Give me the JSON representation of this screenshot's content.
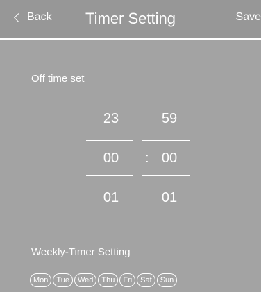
{
  "header": {
    "back_label": "Back",
    "title": "Timer Setting",
    "save_label": "Save"
  },
  "off_time": {
    "label": "Off time set",
    "hours": {
      "prev": "23",
      "current": "00",
      "next": "01"
    },
    "minutes": {
      "prev": "59",
      "current": "00",
      "next": "01"
    },
    "separator": ":"
  },
  "weekly": {
    "label": "Weekly-Timer Setting",
    "days": [
      "Mon",
      "Tue",
      "Wed",
      "Thu",
      "Fri",
      "Sat",
      "Sun"
    ]
  },
  "colors": {
    "header_bg": "#979797",
    "body_bg": "#a3a3a3",
    "text": "#ffffff"
  }
}
